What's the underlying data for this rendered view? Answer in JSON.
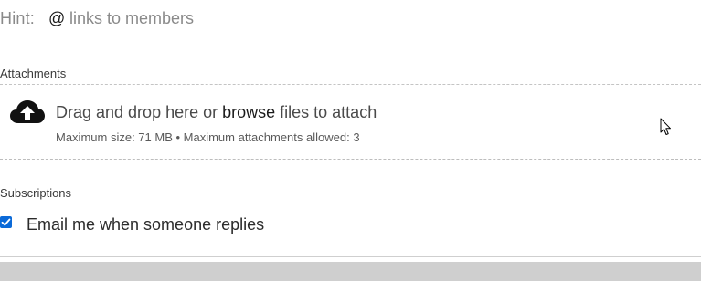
{
  "hint": {
    "label": "Hint:",
    "at_symbol": "@",
    "text": "links to members"
  },
  "attachments": {
    "title": "Attachments",
    "drop_prefix": "Drag and drop here or ",
    "browse_label": "browse",
    "drop_suffix": " files to attach",
    "limits": "Maximum size: 71 MB • Maximum attachments allowed: 3",
    "upload_icon": "cloud-upload-icon"
  },
  "subscriptions": {
    "title": "Subscriptions",
    "email_label": "Email me when someone replies",
    "email_checked": true,
    "checkbox_color": "#0b6ad8"
  }
}
